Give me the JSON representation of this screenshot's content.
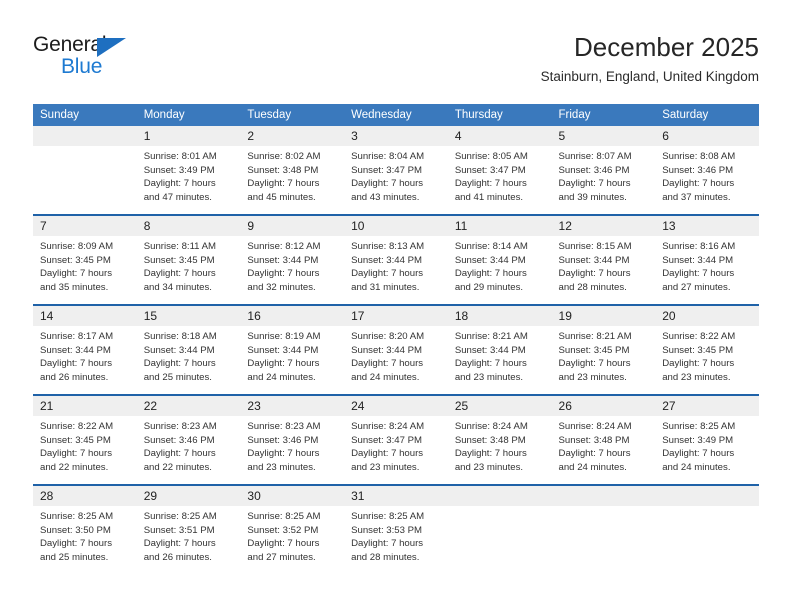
{
  "brand": {
    "name_part1": "General",
    "name_part2": "Blue",
    "accent_color": "#1e7ad1",
    "triangle_color": "#1e6fc0"
  },
  "header": {
    "title": "December 2025",
    "subtitle": "Stainburn, England, United Kingdom"
  },
  "theme": {
    "header_bg": "#3a79bd",
    "row_divider": "#1f62a8",
    "day_band_bg": "#efefef"
  },
  "weekday_headers": [
    "Sunday",
    "Monday",
    "Tuesday",
    "Wednesday",
    "Thursday",
    "Friday",
    "Saturday"
  ],
  "weeks": [
    [
      {
        "day": "",
        "empty": true,
        "sunrise": "",
        "sunset": "",
        "daylight_line1": "",
        "daylight_line2": ""
      },
      {
        "day": "1",
        "empty": false,
        "sunrise": "Sunrise: 8:01 AM",
        "sunset": "Sunset: 3:49 PM",
        "daylight_line1": "Daylight: 7 hours",
        "daylight_line2": "and 47 minutes."
      },
      {
        "day": "2",
        "empty": false,
        "sunrise": "Sunrise: 8:02 AM",
        "sunset": "Sunset: 3:48 PM",
        "daylight_line1": "Daylight: 7 hours",
        "daylight_line2": "and 45 minutes."
      },
      {
        "day": "3",
        "empty": false,
        "sunrise": "Sunrise: 8:04 AM",
        "sunset": "Sunset: 3:47 PM",
        "daylight_line1": "Daylight: 7 hours",
        "daylight_line2": "and 43 minutes."
      },
      {
        "day": "4",
        "empty": false,
        "sunrise": "Sunrise: 8:05 AM",
        "sunset": "Sunset: 3:47 PM",
        "daylight_line1": "Daylight: 7 hours",
        "daylight_line2": "and 41 minutes."
      },
      {
        "day": "5",
        "empty": false,
        "sunrise": "Sunrise: 8:07 AM",
        "sunset": "Sunset: 3:46 PM",
        "daylight_line1": "Daylight: 7 hours",
        "daylight_line2": "and 39 minutes."
      },
      {
        "day": "6",
        "empty": false,
        "sunrise": "Sunrise: 8:08 AM",
        "sunset": "Sunset: 3:46 PM",
        "daylight_line1": "Daylight: 7 hours",
        "daylight_line2": "and 37 minutes."
      }
    ],
    [
      {
        "day": "7",
        "empty": false,
        "sunrise": "Sunrise: 8:09 AM",
        "sunset": "Sunset: 3:45 PM",
        "daylight_line1": "Daylight: 7 hours",
        "daylight_line2": "and 35 minutes."
      },
      {
        "day": "8",
        "empty": false,
        "sunrise": "Sunrise: 8:11 AM",
        "sunset": "Sunset: 3:45 PM",
        "daylight_line1": "Daylight: 7 hours",
        "daylight_line2": "and 34 minutes."
      },
      {
        "day": "9",
        "empty": false,
        "sunrise": "Sunrise: 8:12 AM",
        "sunset": "Sunset: 3:44 PM",
        "daylight_line1": "Daylight: 7 hours",
        "daylight_line2": "and 32 minutes."
      },
      {
        "day": "10",
        "empty": false,
        "sunrise": "Sunrise: 8:13 AM",
        "sunset": "Sunset: 3:44 PM",
        "daylight_line1": "Daylight: 7 hours",
        "daylight_line2": "and 31 minutes."
      },
      {
        "day": "11",
        "empty": false,
        "sunrise": "Sunrise: 8:14 AM",
        "sunset": "Sunset: 3:44 PM",
        "daylight_line1": "Daylight: 7 hours",
        "daylight_line2": "and 29 minutes."
      },
      {
        "day": "12",
        "empty": false,
        "sunrise": "Sunrise: 8:15 AM",
        "sunset": "Sunset: 3:44 PM",
        "daylight_line1": "Daylight: 7 hours",
        "daylight_line2": "and 28 minutes."
      },
      {
        "day": "13",
        "empty": false,
        "sunrise": "Sunrise: 8:16 AM",
        "sunset": "Sunset: 3:44 PM",
        "daylight_line1": "Daylight: 7 hours",
        "daylight_line2": "and 27 minutes."
      }
    ],
    [
      {
        "day": "14",
        "empty": false,
        "sunrise": "Sunrise: 8:17 AM",
        "sunset": "Sunset: 3:44 PM",
        "daylight_line1": "Daylight: 7 hours",
        "daylight_line2": "and 26 minutes."
      },
      {
        "day": "15",
        "empty": false,
        "sunrise": "Sunrise: 8:18 AM",
        "sunset": "Sunset: 3:44 PM",
        "daylight_line1": "Daylight: 7 hours",
        "daylight_line2": "and 25 minutes."
      },
      {
        "day": "16",
        "empty": false,
        "sunrise": "Sunrise: 8:19 AM",
        "sunset": "Sunset: 3:44 PM",
        "daylight_line1": "Daylight: 7 hours",
        "daylight_line2": "and 24 minutes."
      },
      {
        "day": "17",
        "empty": false,
        "sunrise": "Sunrise: 8:20 AM",
        "sunset": "Sunset: 3:44 PM",
        "daylight_line1": "Daylight: 7 hours",
        "daylight_line2": "and 24 minutes."
      },
      {
        "day": "18",
        "empty": false,
        "sunrise": "Sunrise: 8:21 AM",
        "sunset": "Sunset: 3:44 PM",
        "daylight_line1": "Daylight: 7 hours",
        "daylight_line2": "and 23 minutes."
      },
      {
        "day": "19",
        "empty": false,
        "sunrise": "Sunrise: 8:21 AM",
        "sunset": "Sunset: 3:45 PM",
        "daylight_line1": "Daylight: 7 hours",
        "daylight_line2": "and 23 minutes."
      },
      {
        "day": "20",
        "empty": false,
        "sunrise": "Sunrise: 8:22 AM",
        "sunset": "Sunset: 3:45 PM",
        "daylight_line1": "Daylight: 7 hours",
        "daylight_line2": "and 23 minutes."
      }
    ],
    [
      {
        "day": "21",
        "empty": false,
        "sunrise": "Sunrise: 8:22 AM",
        "sunset": "Sunset: 3:45 PM",
        "daylight_line1": "Daylight: 7 hours",
        "daylight_line2": "and 22 minutes."
      },
      {
        "day": "22",
        "empty": false,
        "sunrise": "Sunrise: 8:23 AM",
        "sunset": "Sunset: 3:46 PM",
        "daylight_line1": "Daylight: 7 hours",
        "daylight_line2": "and 22 minutes."
      },
      {
        "day": "23",
        "empty": false,
        "sunrise": "Sunrise: 8:23 AM",
        "sunset": "Sunset: 3:46 PM",
        "daylight_line1": "Daylight: 7 hours",
        "daylight_line2": "and 23 minutes."
      },
      {
        "day": "24",
        "empty": false,
        "sunrise": "Sunrise: 8:24 AM",
        "sunset": "Sunset: 3:47 PM",
        "daylight_line1": "Daylight: 7 hours",
        "daylight_line2": "and 23 minutes."
      },
      {
        "day": "25",
        "empty": false,
        "sunrise": "Sunrise: 8:24 AM",
        "sunset": "Sunset: 3:48 PM",
        "daylight_line1": "Daylight: 7 hours",
        "daylight_line2": "and 23 minutes."
      },
      {
        "day": "26",
        "empty": false,
        "sunrise": "Sunrise: 8:24 AM",
        "sunset": "Sunset: 3:48 PM",
        "daylight_line1": "Daylight: 7 hours",
        "daylight_line2": "and 24 minutes."
      },
      {
        "day": "27",
        "empty": false,
        "sunrise": "Sunrise: 8:25 AM",
        "sunset": "Sunset: 3:49 PM",
        "daylight_line1": "Daylight: 7 hours",
        "daylight_line2": "and 24 minutes."
      }
    ],
    [
      {
        "day": "28",
        "empty": false,
        "sunrise": "Sunrise: 8:25 AM",
        "sunset": "Sunset: 3:50 PM",
        "daylight_line1": "Daylight: 7 hours",
        "daylight_line2": "and 25 minutes."
      },
      {
        "day": "29",
        "empty": false,
        "sunrise": "Sunrise: 8:25 AM",
        "sunset": "Sunset: 3:51 PM",
        "daylight_line1": "Daylight: 7 hours",
        "daylight_line2": "and 26 minutes."
      },
      {
        "day": "30",
        "empty": false,
        "sunrise": "Sunrise: 8:25 AM",
        "sunset": "Sunset: 3:52 PM",
        "daylight_line1": "Daylight: 7 hours",
        "daylight_line2": "and 27 minutes."
      },
      {
        "day": "31",
        "empty": false,
        "sunrise": "Sunrise: 8:25 AM",
        "sunset": "Sunset: 3:53 PM",
        "daylight_line1": "Daylight: 7 hours",
        "daylight_line2": "and 28 minutes."
      },
      {
        "day": "",
        "empty": true,
        "sunrise": "",
        "sunset": "",
        "daylight_line1": "",
        "daylight_line2": ""
      },
      {
        "day": "",
        "empty": true,
        "sunrise": "",
        "sunset": "",
        "daylight_line1": "",
        "daylight_line2": ""
      },
      {
        "day": "",
        "empty": true,
        "sunrise": "",
        "sunset": "",
        "daylight_line1": "",
        "daylight_line2": ""
      }
    ]
  ]
}
